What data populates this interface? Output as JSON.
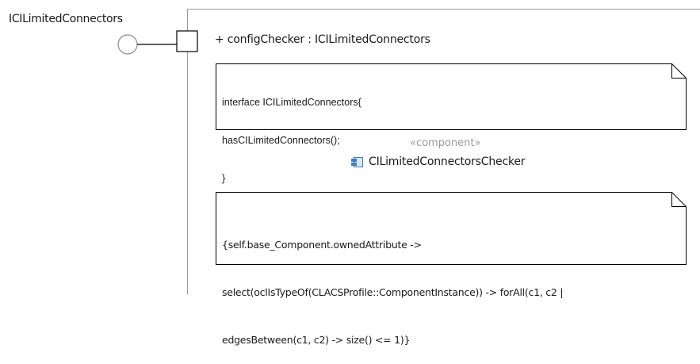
{
  "port": {
    "name": "ICILimitedConnectors"
  },
  "property": {
    "label": "+ configChecker : ICILimitedConnectors"
  },
  "notes": [
    {
      "lines": [
        "interface ICILimitedConnectors{",
        "hasCILimitedConnectors();",
        "}"
      ]
    },
    {
      "lines": [
        "{self.base_Component.ownedAttribute ->",
        "select(oclIsTypeOf(CLACSProfile::ComponentInstance)) -> forAll(c1, c2 |",
        "edgesBetween(c1, c2) -> size() <= 1)}"
      ]
    }
  ],
  "component": {
    "stereotype": "«component»",
    "name": "CILimitedConnectorsChecker",
    "icon": "component-icon"
  },
  "colors": {
    "frame_border": "#9a9a9a",
    "note_border": "#000000",
    "stereotype_text": "#9a9a9a",
    "component_icon": "#3b7fc4"
  }
}
